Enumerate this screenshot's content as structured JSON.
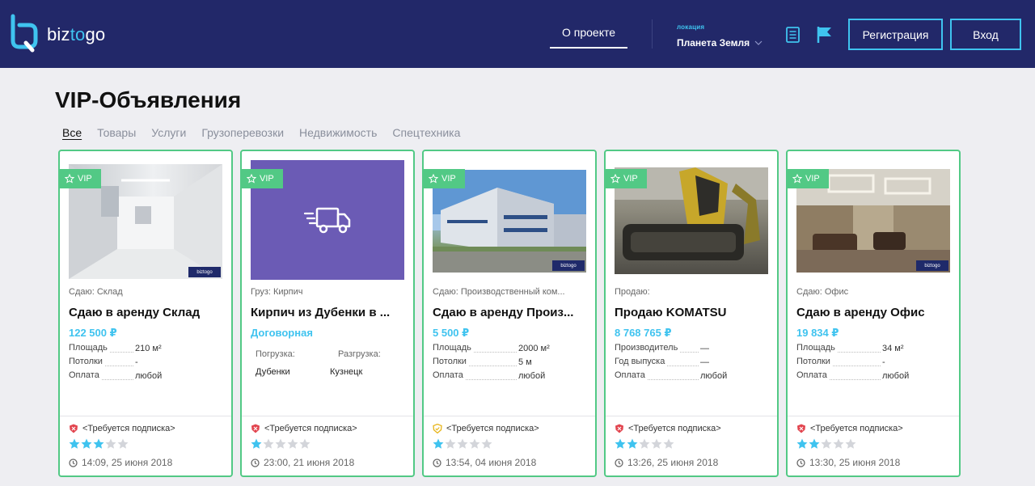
{
  "header": {
    "logo_text_a": "biz",
    "logo_text_b": "to",
    "logo_text_c": "go",
    "nav_about": "О проекте",
    "location_label": "локация",
    "location_value": "Планета Земля",
    "btn_register": "Регистрация",
    "btn_login": "Вход",
    "icons": [
      "logo-icon",
      "document-icon",
      "flag-icon",
      "chevron-down-icon"
    ]
  },
  "page": {
    "title": "VIP-Объявления",
    "tabs": [
      "Все",
      "Товары",
      "Услуги",
      "Грузоперевозки",
      "Недвижимость",
      "Спецтехника"
    ],
    "active_tab": "Все"
  },
  "colors": {
    "header_bg": "#222869",
    "accent_blue": "#3fc3ef",
    "vip_green": "#52c985",
    "price_blue": "#3fc3ef",
    "page_bg": "#eeeef2",
    "truck_bg": "#6b5bb5"
  },
  "cards": [
    {
      "vip": "VIP",
      "category": "Сдаю: Склад",
      "title": "Сдаю в аренду Склад",
      "price": "122 500 ₽",
      "props": [
        {
          "k": "Площадь",
          "v": "210 м²"
        },
        {
          "k": "Потолки",
          "v": "-"
        },
        {
          "k": "Оплата",
          "v": "любой"
        }
      ],
      "subscription": "<Требуется подписка>",
      "rating": 3,
      "date": "14:09, 25 июня 2018",
      "image": "corridor-photo"
    },
    {
      "vip": "VIP",
      "category": "Груз: Кирпич",
      "title": "Кирпич из Дубенки в ...",
      "price": "Договорная",
      "route": {
        "from_label": "Погрузка:",
        "to_label": "Разгрузка:",
        "from": "Дубенки",
        "to": "Кузнецк"
      },
      "subscription": "<Требуется подписка>",
      "rating": 1,
      "date": "23:00, 21 июня 2018",
      "image": "truck-icon"
    },
    {
      "vip": "VIP",
      "category": "Сдаю: Производственный ком...",
      "title": "Сдаю в аренду Произ...",
      "price": "5 500 ₽",
      "props": [
        {
          "k": "Площадь",
          "v": "2000 м²"
        },
        {
          "k": "Потолки",
          "v": "5 м"
        },
        {
          "k": "Оплата",
          "v": "любой"
        }
      ],
      "subscription": "<Требуется подписка>",
      "rating": 1,
      "date": "13:54, 04 июня 2018",
      "image": "building-photo"
    },
    {
      "vip": "VIP",
      "category": "Продаю:",
      "title": "Продаю KOMATSU",
      "price": "8 768 765 ₽",
      "props": [
        {
          "k": "Производитель",
          "v": "—"
        },
        {
          "k": "Год выпуска",
          "v": "—"
        },
        {
          "k": "Оплата",
          "v": "любой"
        }
      ],
      "subscription": "<Требуется подписка>",
      "rating": 2,
      "date": "13:26, 25 июня 2018",
      "image": "excavator-photo"
    },
    {
      "vip": "VIP",
      "category": "Сдаю: Офис",
      "title": "Сдаю в аренду Офис",
      "price": "19 834 ₽",
      "props": [
        {
          "k": "Площадь",
          "v": "34 м²"
        },
        {
          "k": "Потолки",
          "v": "-"
        },
        {
          "k": "Оплата",
          "v": "любой"
        }
      ],
      "subscription": "<Требуется подписка>",
      "rating": 2,
      "date": "13:30, 25 июня 2018",
      "image": "office-photo"
    }
  ]
}
